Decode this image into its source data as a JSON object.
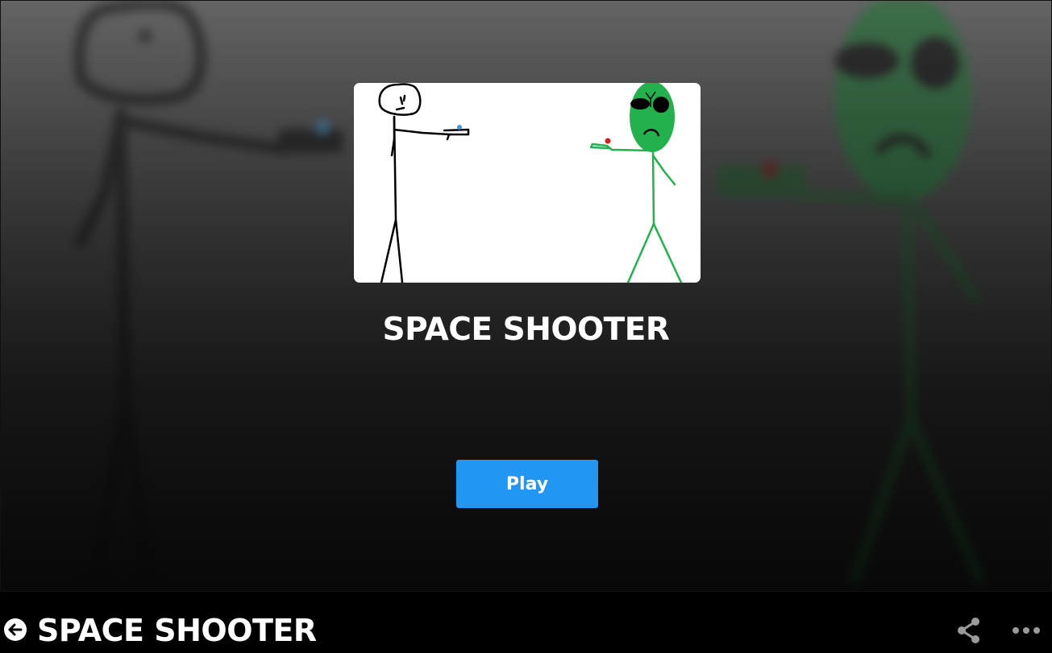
{
  "game": {
    "title": "SPACE SHOOTER",
    "play_label": "Play"
  },
  "bottom_bar": {
    "title": "SPACE SHOOTER",
    "back_icon": "arrow-left-circle-icon",
    "share_icon": "share-icon",
    "more_icon": "more-horizontal-icon"
  },
  "colors": {
    "play_button": "#2196f3",
    "alien_green": "#22b14c",
    "human_gun": "#3a9ad9",
    "alien_gun_light": "#cc2222"
  }
}
